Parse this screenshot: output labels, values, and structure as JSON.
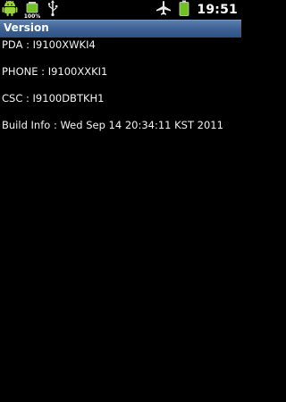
{
  "status_bar": {
    "time": "19:51",
    "battery_label": "100%",
    "icons": [
      "android-icon",
      "battery-100-icon",
      "usb-icon",
      "airplane-mode-icon",
      "battery-full-icon"
    ]
  },
  "title_bar": {
    "title": "Version"
  },
  "info": {
    "pda": "PDA : I9100XWKI4",
    "phone": "PHONE : I9100XXKI1",
    "csc": "CSC : I9100DBTKH1",
    "build": "Build Info : Wed Sep 14 20:34:11 KST 2011"
  }
}
